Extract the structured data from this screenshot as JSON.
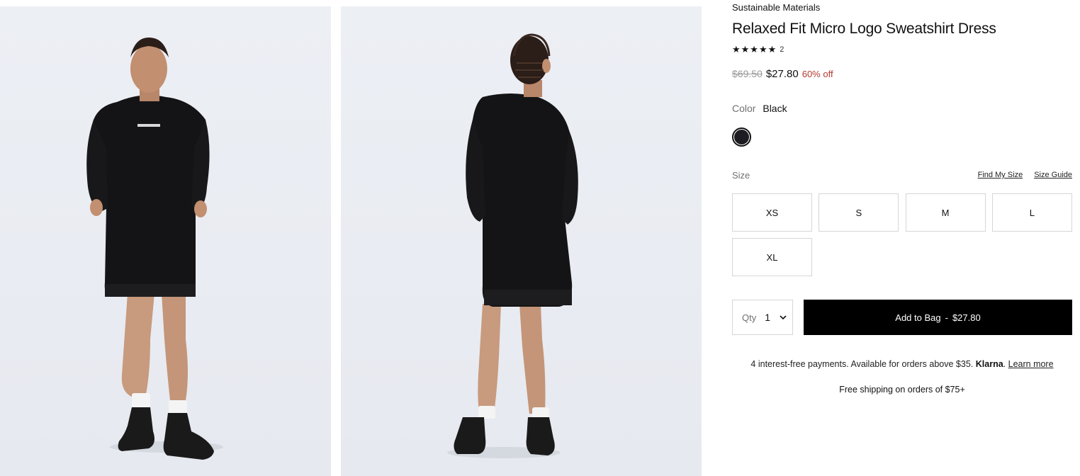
{
  "product": {
    "eyebrow": "Sustainable Materials",
    "title": "Relaxed Fit Micro Logo Sweatshirt Dress",
    "rating": {
      "stars": "★★★★★",
      "value": 5,
      "count": "2"
    },
    "price": {
      "original": "$69.50",
      "sale": "$27.80",
      "discount": "60% off"
    },
    "color": {
      "label": "Color",
      "value": "Black",
      "swatch_hex": "#1c1c22"
    },
    "size": {
      "label": "Size",
      "find_my_size": "Find My Size",
      "size_guide": "Size Guide",
      "options": [
        "XS",
        "S",
        "M",
        "L",
        "XL"
      ]
    },
    "quantity": {
      "label": "Qty",
      "value": "1",
      "icon": "chevron-down-icon"
    },
    "add_to_bag": {
      "label": "Add to Bag",
      "separator": "-",
      "price": "$27.80"
    },
    "klarna": {
      "text": "4 interest-free payments. Available for orders above $35.",
      "brand": "Klarna",
      "period": ".",
      "link": "Learn more"
    },
    "shipping": "Free shipping on orders of $75+",
    "colors": {
      "sale_red": "#b23a32",
      "button_black": "#000000",
      "muted_text": "#707070",
      "border": "#d6d6d6"
    }
  },
  "gallery": {
    "images": [
      {
        "view": "front",
        "logo_text": "Calvin Klein Jeans"
      },
      {
        "view": "back"
      }
    ]
  }
}
